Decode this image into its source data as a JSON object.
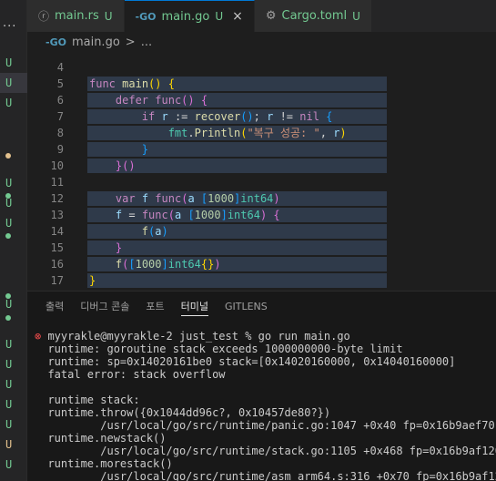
{
  "explorer": {
    "more_label": "···",
    "rows": [
      {
        "mark": "U",
        "cls": "u"
      },
      {
        "mark": "U",
        "cls": "u",
        "selected": true
      },
      {
        "mark": "U",
        "cls": "u"
      },
      {
        "mark": "U",
        "cls": "u"
      },
      {
        "mark": "U",
        "cls": "u"
      },
      {
        "mark": "U",
        "cls": "u"
      },
      {
        "mark": "U",
        "cls": "u"
      },
      {
        "mark": "U",
        "cls": "u"
      },
      {
        "mark": "U",
        "cls": "u"
      },
      {
        "mark": "U",
        "cls": "u"
      },
      {
        "mark": "U",
        "cls": "u"
      },
      {
        "mark": "U",
        "cls": "u"
      },
      {
        "mark": "U",
        "cls": "m"
      },
      {
        "mark": "U",
        "cls": "u"
      }
    ]
  },
  "tabs": [
    {
      "icon": "rust-icon",
      "glyph": "ⓡ",
      "label": "main.rs",
      "mark": "U",
      "active": false
    },
    {
      "icon": "go-icon",
      "glyph": "-GO",
      "label": "main.go",
      "mark": "U",
      "active": true,
      "close": "×"
    },
    {
      "icon": "gear-icon",
      "glyph": "⚙",
      "label": "Cargo.toml",
      "mark": "U",
      "active": false
    }
  ],
  "breadcrumb": {
    "icon_glyph": "-GO",
    "file": "main.go",
    "sep": ">",
    "more": "..."
  },
  "editor": {
    "lines": [
      {
        "n": "4",
        "html": ""
      },
      {
        "n": "5",
        "html": "<span class='kw'>func</span> <span class='fn'>main</span><span class='brk'>()</span> <span class='brk'>{</span>"
      },
      {
        "n": "6",
        "html": "    <span class='kw'>defer</span> <span class='kw'>func</span><span class='brk2'>()</span> <span class='brk2'>{</span>"
      },
      {
        "n": "7",
        "html": "        <span class='kw'>if</span> <span class='var'>r</span> := <span class='fn'>recover</span><span class='brk3'>()</span>; <span class='var'>r</span> != <span class='kw'>nil</span> <span class='brk3'>{</span>"
      },
      {
        "n": "8",
        "html": "            <span class='typ'>fmt</span>.<span class='fn'>Println</span><span class='brk'>(</span><span class='str'>\"복구 성공: \"</span>, <span class='var'>r</span><span class='brk'>)</span>"
      },
      {
        "n": "9",
        "html": "        <span class='brk3'>}</span>"
      },
      {
        "n": "10",
        "html": "    <span class='brk2'>}</span><span class='brk2'>()</span>"
      },
      {
        "n": "11",
        "html": ""
      },
      {
        "n": "12",
        "html": "    <span class='kw'>var</span> <span class='var'>f</span> <span class='kw'>func</span><span class='brk2'>(</span><span class='var'>a</span> <span class='brk3'>[</span><span class='num'>1000</span><span class='brk3'>]</span><span class='typ'>int64</span><span class='brk2'>)</span>"
      },
      {
        "n": "13",
        "html": "    <span class='var'>f</span> = <span class='kw'>func</span><span class='brk2'>(</span><span class='var'>a</span> <span class='brk3'>[</span><span class='num'>1000</span><span class='brk3'>]</span><span class='typ'>int64</span><span class='brk2'>)</span> <span class='brk2'>{</span>"
      },
      {
        "n": "14",
        "html": "        <span class='fn'>f</span><span class='brk3'>(</span><span class='var'>a</span><span class='brk3'>)</span>"
      },
      {
        "n": "15",
        "html": "    <span class='brk2'>}</span>"
      },
      {
        "n": "16",
        "html": "    <span class='fn'>f</span><span class='brk2'>(</span><span class='brk3'>[</span><span class='num'>1000</span><span class='brk3'>]</span><span class='typ'>int64</span><span class='brk'>{}</span><span class='brk2'>)</span>"
      },
      {
        "n": "17",
        "html": "<span class='brk'>}</span>"
      }
    ]
  },
  "panel": {
    "tabs": [
      "출력",
      "디버그 콘솔",
      "포트",
      "터미널",
      "GITLENS"
    ],
    "active_tab": "터미널",
    "terminal": [
      {
        "err": true,
        "text": "myyrakle@myyrakle-2 just_test % go run main.go"
      },
      {
        "text": "runtime: goroutine stack exceeds 1000000000-byte limit"
      },
      {
        "text": "runtime: sp=0x14020161be0 stack=[0x14020160000, 0x14040160000]"
      },
      {
        "text": "fatal error: stack overflow"
      },
      {
        "text": ""
      },
      {
        "text": "runtime stack:"
      },
      {
        "text": "runtime.throw({0x1044dd96c?, 0x10457de80?})"
      },
      {
        "text": "        /usr/local/go/src/runtime/panic.go:1047 +0x40 fp=0x16b9aef70 sp"
      },
      {
        "text": "runtime.newstack()"
      },
      {
        "text": "        /usr/local/go/src/runtime/stack.go:1105 +0x468 fp=0x16b9af120 s"
      },
      {
        "text": "runtime.morestack()"
      },
      {
        "text": "        /usr/local/go/src/runtime/asm_arm64.s:316 +0x70 fp=0x16b9af120"
      }
    ]
  }
}
